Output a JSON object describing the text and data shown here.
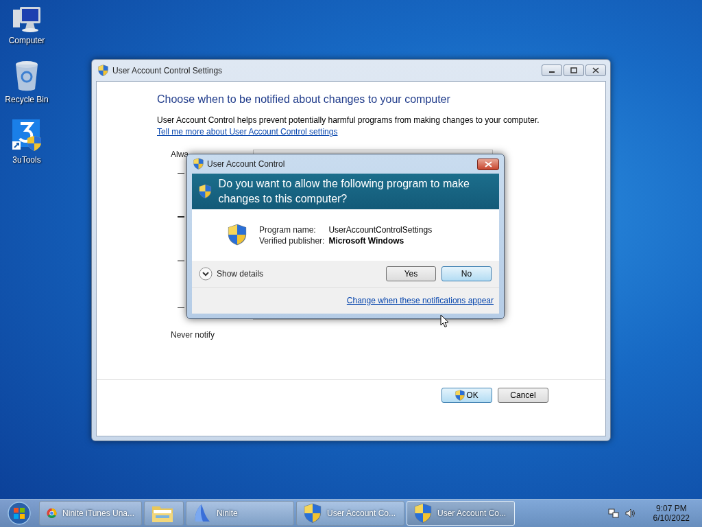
{
  "desktop_icons": [
    {
      "label": "Computer",
      "kind": "computer"
    },
    {
      "label": "Recycle Bin",
      "kind": "recycle-bin"
    },
    {
      "label": "3uTools",
      "kind": "app-shortcut"
    }
  ],
  "settings_window": {
    "title": "User Account Control Settings",
    "heading": "Choose when to be notified about changes to your computer",
    "description": "User Account Control helps prevent potentially harmful programs from making changes to your computer.",
    "link": "Tell me more about User Account Control settings",
    "slider": {
      "top_label": "Alwa",
      "bottom_label": "Never notify"
    },
    "buttons": [
      {
        "label": "OK",
        "kind": "shield",
        "default": true
      },
      {
        "label": "Cancel",
        "kind": "plain",
        "default": false
      }
    ]
  },
  "uac_dialog": {
    "title": "User Account Control",
    "question": "Do you want to allow the following program to make changes to this computer?",
    "fields": [
      {
        "label": "Program name:",
        "value": "UserAccountControlSettings",
        "bold": false
      },
      {
        "label": "Verified publisher:",
        "value": "Microsoft Windows",
        "bold": true
      }
    ],
    "details_toggle": {
      "label": "Show details",
      "expanded": false
    },
    "buttons": [
      {
        "label": "Yes",
        "default": false
      },
      {
        "label": "No",
        "default": true
      }
    ],
    "link": "Change when these notifications appear"
  },
  "taskbar": {
    "items": [
      {
        "label": "Ninite iTunes Una...",
        "kind": "chrome",
        "selected": false
      },
      {
        "kind": "folder",
        "selected": false
      },
      {
        "label": "Ninite",
        "kind": "ninite",
        "selected": false
      },
      {
        "label": "User Account Co...",
        "kind": "shield",
        "selected": false
      },
      {
        "label": "User Account Co...",
        "kind": "shield",
        "selected": true
      }
    ],
    "clock": {
      "time": "9:07 PM",
      "date": "6/10/2022"
    }
  }
}
